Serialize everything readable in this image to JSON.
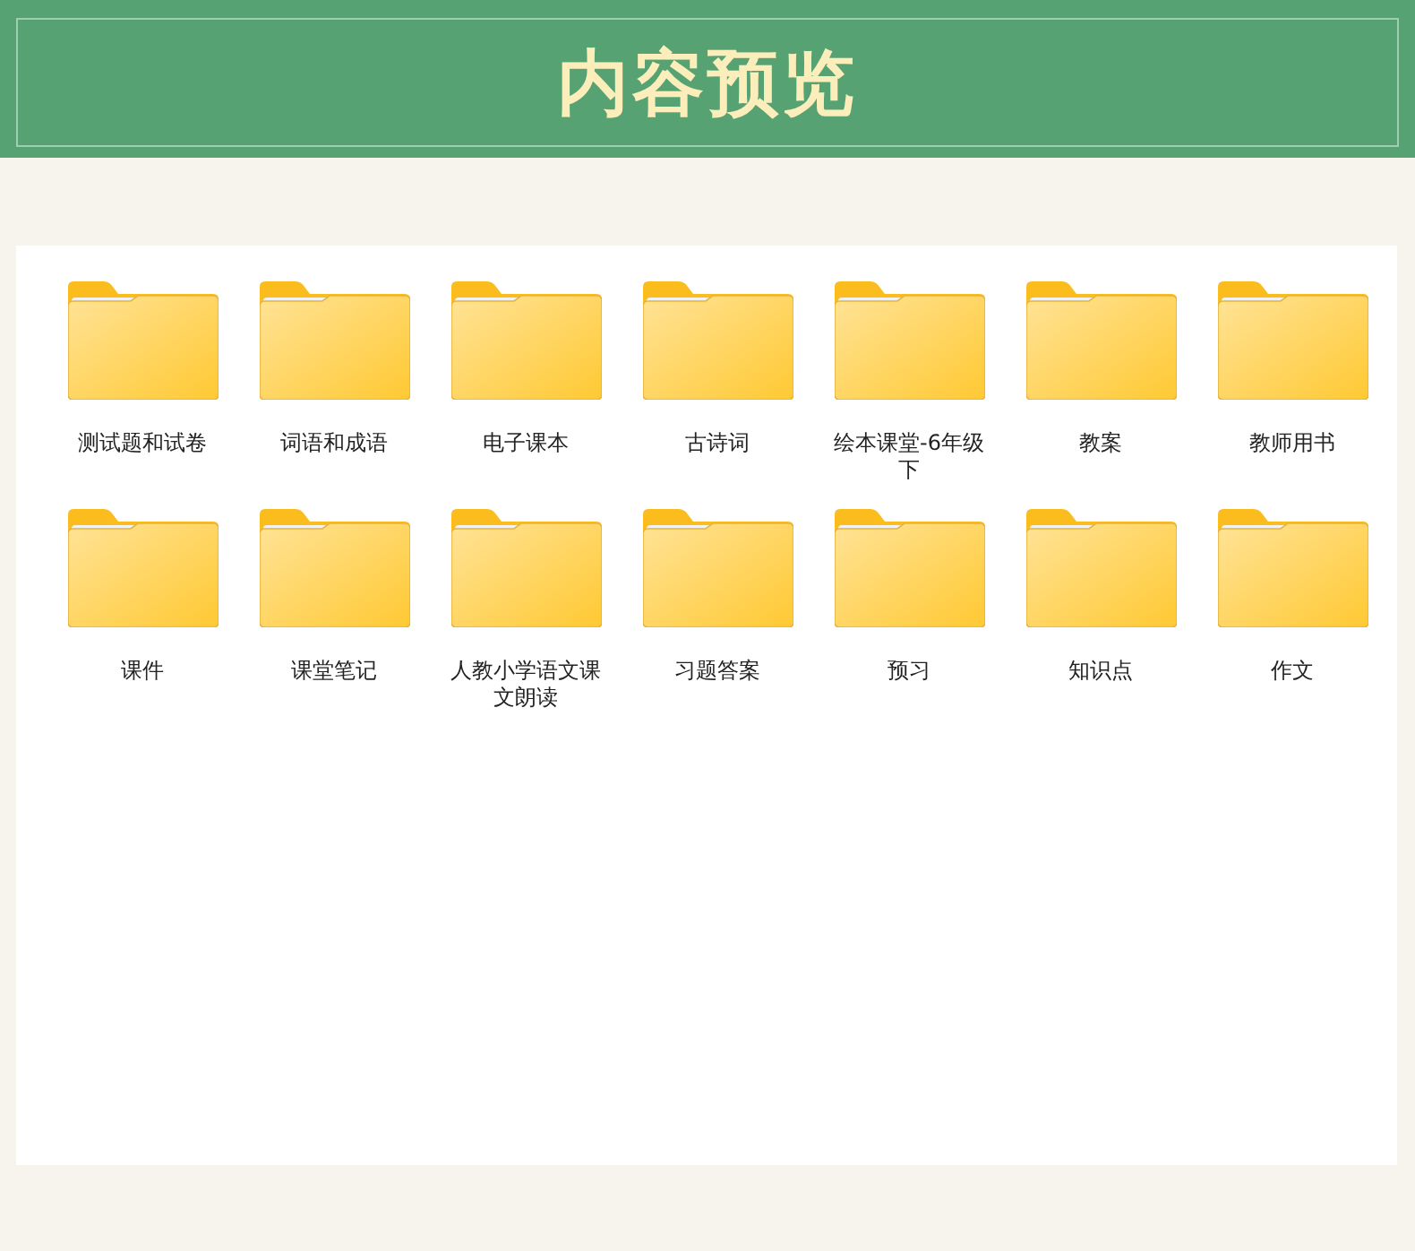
{
  "header": {
    "title": "内容预览"
  },
  "folders": [
    {
      "label": "测试题和试卷"
    },
    {
      "label": "词语和成语"
    },
    {
      "label": "电子课本"
    },
    {
      "label": "古诗词"
    },
    {
      "label": "绘本课堂-6年级下"
    },
    {
      "label": "教案"
    },
    {
      "label": "教师用书"
    },
    {
      "label": "课件"
    },
    {
      "label": "课堂笔记"
    },
    {
      "label": "人教小学语文课文朗读"
    },
    {
      "label": "习题答案"
    },
    {
      "label": "预习"
    },
    {
      "label": "知识点"
    },
    {
      "label": "作文"
    }
  ]
}
